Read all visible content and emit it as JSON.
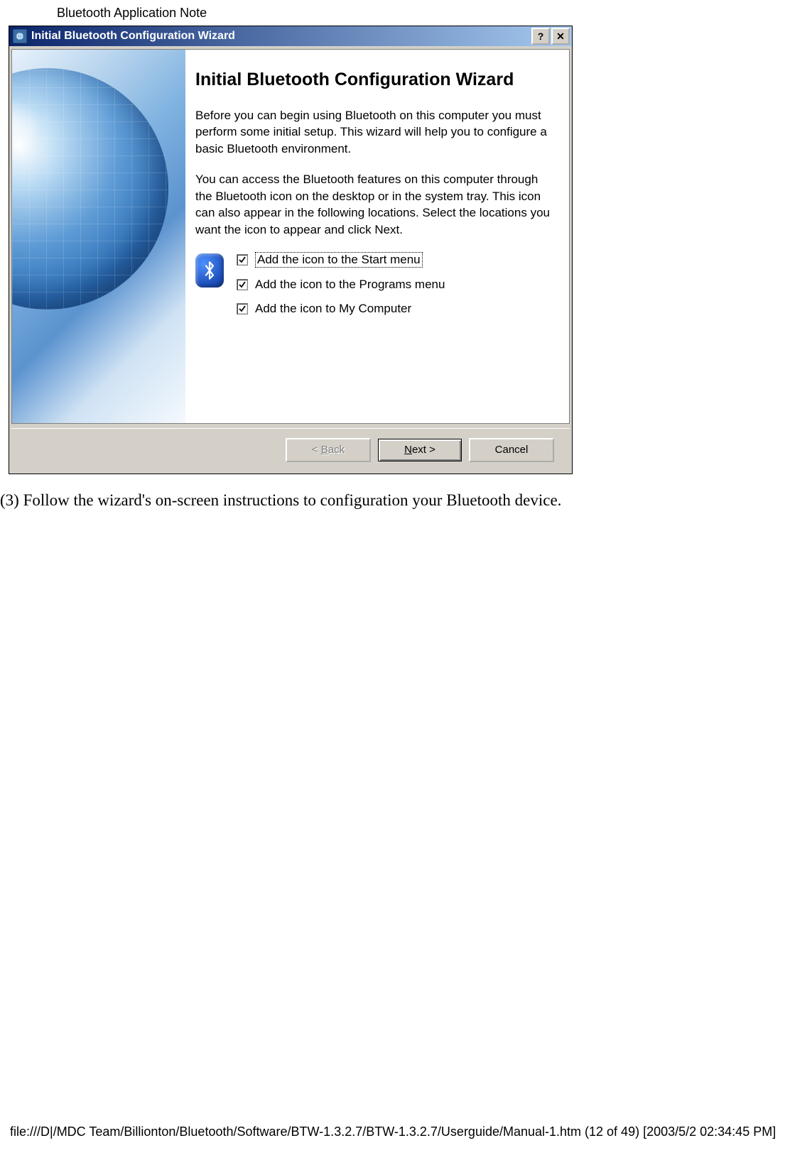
{
  "doc": {
    "header": "Bluetooth Application Note",
    "instruction": "(3) Follow the wizard's on-screen instructions to configuration your Bluetooth device.",
    "footer": "file:///D|/MDC Team/Billionton/Bluetooth/Software/BTW-1.3.2.7/BTW-1.3.2.7/Userguide/Manual-1.htm (12 of 49) [2003/5/2 02:34:45 PM]"
  },
  "dialog": {
    "title": "Initial Bluetooth Configuration Wizard",
    "help_glyph": "?",
    "close_glyph": "✕",
    "heading": "Initial Bluetooth Configuration Wizard",
    "para1": "Before you can begin using Bluetooth on this computer you must perform some initial setup. This wizard will help you to configure a basic Bluetooth environment.",
    "para2": "You can access the Bluetooth features on this computer through the Bluetooth icon on the desktop or in the system tray. This icon can also appear in the following locations. Select the locations you want the icon to appear and click Next.",
    "options": {
      "0": {
        "label": "Add the icon to the Start menu",
        "checked": true,
        "focused": true
      },
      "1": {
        "label": "Add the icon to the Programs menu",
        "checked": true,
        "focused": false
      },
      "2": {
        "label": "Add the icon to My Computer",
        "checked": true,
        "focused": false
      }
    },
    "buttons": {
      "back_prefix": "< ",
      "back_u": "B",
      "back_suffix": "ack",
      "next_u": "N",
      "next_suffix": "ext >",
      "cancel": "Cancel"
    }
  }
}
